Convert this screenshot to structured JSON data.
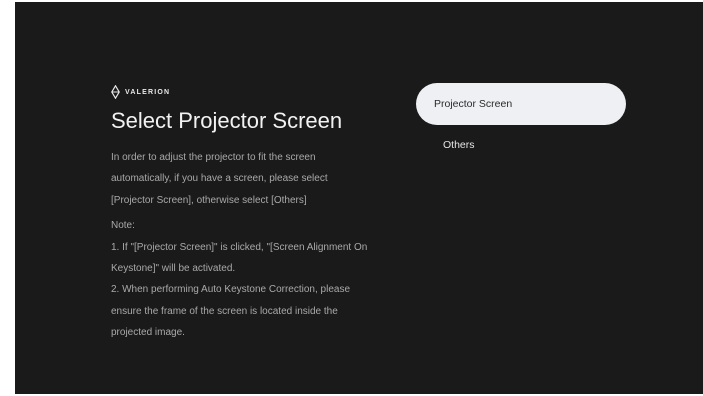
{
  "brand": {
    "logo_text": "VALERION",
    "logo_icon": "valerion-diamond-icon"
  },
  "dialog": {
    "title": "Select Projector Screen",
    "description": "In order to adjust the projector to fit the screen automatically, if you have a screen, please select [Projector Screen], otherwise select [Others]",
    "note_label": "Note:",
    "note_1": "1. If \"[Projector Screen]\" is clicked, \"[Screen Alignment On Keystone]\" will be activated.",
    "note_2": "2. When performing Auto Keystone Correction, please ensure the frame of the screen is located inside the projected image."
  },
  "options": [
    {
      "label": "Projector Screen",
      "selected": true
    },
    {
      "label": "Others",
      "selected": false
    }
  ],
  "colors": {
    "background": "#1a1a1a",
    "selected_option": "#eef0f3",
    "title": "#f2f2f2",
    "body_text": "#a9a9a9"
  }
}
